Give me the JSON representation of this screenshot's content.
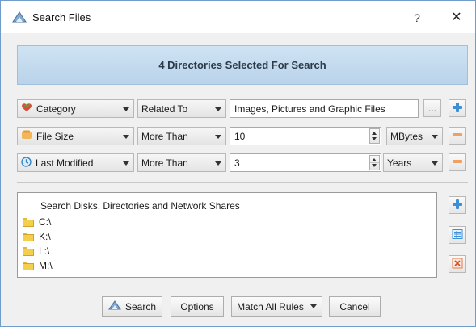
{
  "window": {
    "title": "Search Files",
    "help_label": "?",
    "close_label": "✕"
  },
  "banner": {
    "text": "4 Directories Selected For Search"
  },
  "rules": [
    {
      "field": "Category",
      "field_icon": "category-heart-icon",
      "operator": "Related To",
      "value": "Images, Pictures and Graphic Files",
      "browse_label": "..."
    },
    {
      "field": "File Size",
      "field_icon": "file-size-icon",
      "operator": "More Than",
      "value": "10",
      "unit": "MBytes"
    },
    {
      "field": "Last Modified",
      "field_icon": "clock-icon",
      "operator": "More Than",
      "value": "3",
      "unit": "Years"
    }
  ],
  "locations": {
    "header": "Search Disks, Directories and Network Shares",
    "items": [
      "C:\\",
      "K:\\",
      "L:\\",
      "M:\\"
    ]
  },
  "buttons": {
    "search": "Search",
    "options": "Options",
    "match": "Match All Rules",
    "cancel": "Cancel"
  },
  "colors": {
    "banner_bg": "#c6dcf0",
    "window_border": "#6f9cc9",
    "add_icon": "#3d8fd6",
    "remove_icon": "#f0a060"
  }
}
